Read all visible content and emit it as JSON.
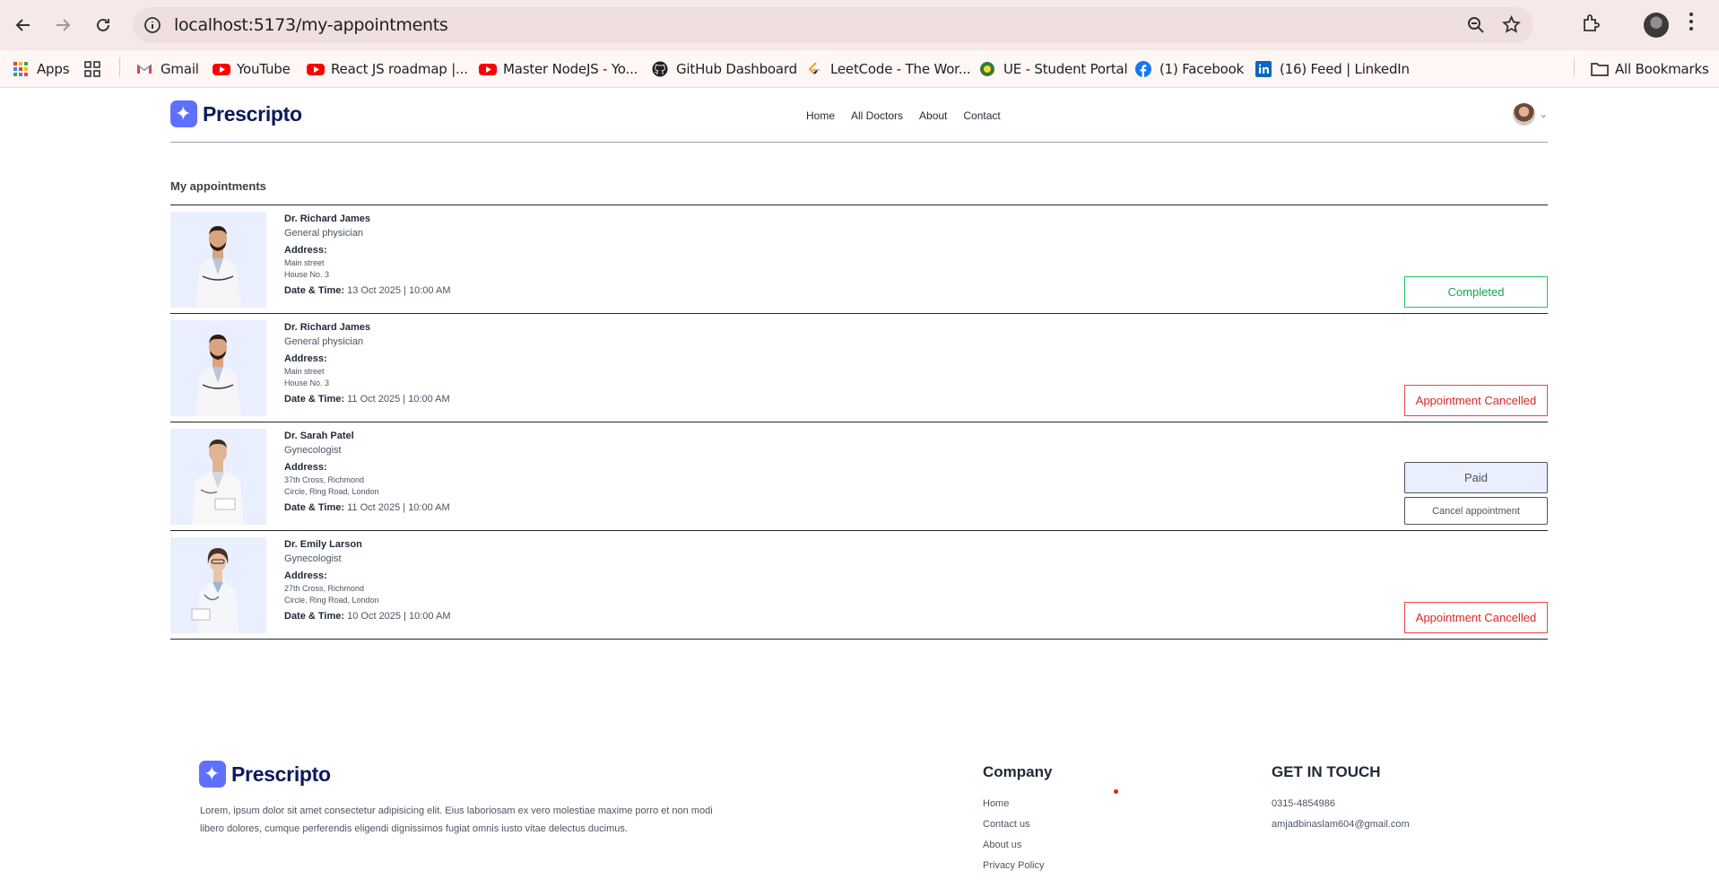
{
  "browser": {
    "url": "localhost:5173/my-appointments",
    "bookmarks": [
      {
        "label": "Apps",
        "icon": "apps-grid-icon"
      },
      {
        "label": "",
        "icon": "tab-groups-icon"
      },
      {
        "label": "Gmail",
        "icon": "gmail-icon"
      },
      {
        "label": "YouTube",
        "icon": "youtube-icon"
      },
      {
        "label": "React JS roadmap |...",
        "icon": "youtube-icon"
      },
      {
        "label": "Master NodeJS - Yo...",
        "icon": "youtube-icon"
      },
      {
        "label": "GitHub Dashboard",
        "icon": "github-icon"
      },
      {
        "label": "LeetCode - The Wor...",
        "icon": "leetcode-icon"
      },
      {
        "label": "UE - Student Portal",
        "icon": "ue-icon"
      },
      {
        "label": "(1) Facebook",
        "icon": "facebook-icon"
      },
      {
        "label": "(16) Feed | LinkedIn",
        "icon": "linkedin-icon"
      }
    ],
    "all_bookmarks": "All Bookmarks"
  },
  "header": {
    "brand": "Prescripto",
    "nav": [
      "Home",
      "All Doctors",
      "About",
      "Contact"
    ]
  },
  "page": {
    "title": "My appointments",
    "address_label": "Address:",
    "datetime_label": "Date & Time:"
  },
  "appointments": [
    {
      "name": "Dr. Richard James",
      "speciality": "General physician",
      "address_line1": "Main street",
      "address_line2": "House No. 3",
      "datetime": "13 Oct 2025 | 10:00 AM",
      "status": "Completed"
    },
    {
      "name": "Dr. Richard James",
      "speciality": "General physician",
      "address_line1": "Main street",
      "address_line2": "House No. 3",
      "datetime": "11 Oct 2025 | 10:00 AM",
      "status": "Appointment Cancelled"
    },
    {
      "name": "Dr. Sarah Patel",
      "speciality": "Gynecologist",
      "address_line1": "37th Cross, Richmond",
      "address_line2": "Circle, Ring Road, London",
      "datetime": "11 Oct 2025 | 10:00 AM",
      "status": "Paid",
      "secondary_action": "Cancel appointment"
    },
    {
      "name": "Dr. Emily Larson",
      "speciality": "Gynecologist",
      "address_line1": "27th Cross, Richmond",
      "address_line2": "Circle, Ring Road, London",
      "datetime": "10 Oct 2025 | 10:00 AM",
      "status": "Appointment Cancelled"
    }
  ],
  "footer": {
    "brand": "Prescripto",
    "description": "Lorem, ipsum dolor sit amet consectetur adipisicing elit. Eius laboriosam ex vero molestiae maxime porro et non modi libero dolores, cumque perferendis eligendi dignissimos fugiat omnis iusto vitae delectus ducimus.",
    "company_title": "Company",
    "company_links": [
      "Home",
      "Contact us",
      "About us",
      "Privacy Policy"
    ],
    "contact_title": "GET IN TOUCH",
    "phone": "0315-4854986",
    "email": "amjadbinaslam604@gmail.com"
  },
  "colors": {
    "brand": "#5f6fff",
    "completed": "#16a34a",
    "cancelled": "#dc2626",
    "paid_bg": "#eaefff"
  }
}
